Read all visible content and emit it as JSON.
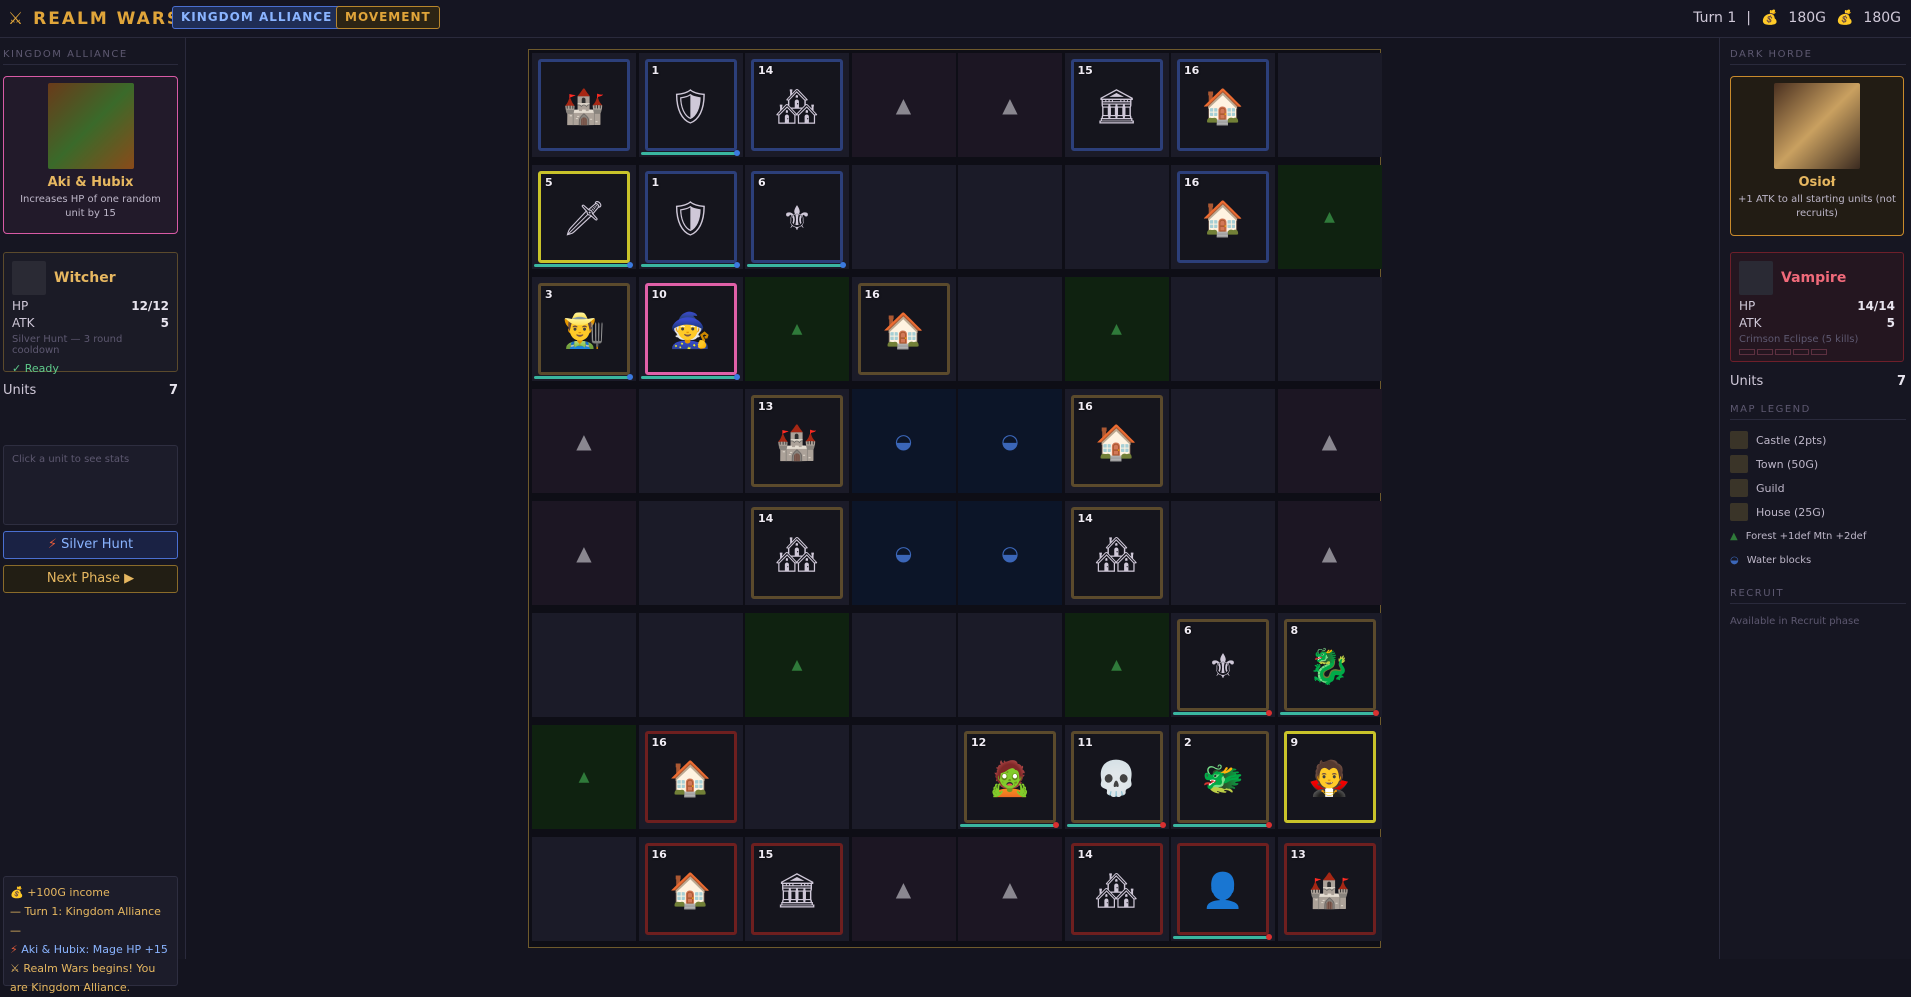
{
  "header": {
    "logo": "⚔ REALM WARS",
    "team_pill": "KINGDOM ALLIANCE",
    "phase_pill": "MOVEMENT",
    "turn": "Turn 1",
    "sep": "|",
    "gold_left": "180G",
    "gold_right": "180G"
  },
  "left": {
    "section": "KINGDOM ALLIANCE",
    "leader": {
      "name": "Aki & Hubix",
      "desc": "Increases HP of one random unit by 15"
    },
    "unit": {
      "name": "Witcher",
      "hp_label": "HP",
      "hp": "12/12",
      "atk_label": "ATK",
      "atk": "5",
      "skill": "Silver Hunt — 3 round cooldown",
      "ready": "✓ Ready"
    },
    "units_label": "Units",
    "units": "7",
    "info_placeholder": "Click a unit to see stats",
    "skill_button": "Silver Hunt",
    "next_button": "Next Phase ▶",
    "log": [
      "+100G income",
      "— Turn 1: Kingdom Alliance —",
      "Aki & Hubix: Mage HP +15",
      "⚔ Realm Wars begins! You are Kingdom Alliance."
    ]
  },
  "right": {
    "section": "DARK HORDE",
    "leader": {
      "name": "Osioł",
      "desc": "+1 ATK to all starting units (not recruits)"
    },
    "unit": {
      "name": "Vampire",
      "hp_label": "HP",
      "hp": "14/14",
      "atk_label": "ATK",
      "atk": "5",
      "skill": "Crimson Eclipse (5 kills)"
    },
    "units_label": "Units",
    "units": "7",
    "legend_title": "MAP LEGEND",
    "legend": [
      "Castle (2pts)",
      "Town (50G)",
      "Guild",
      "House (25G)"
    ],
    "legend_terrain": "Forest +1def  Mtn +2def",
    "legend_water": "Water blocks",
    "recruit_title": "RECRUIT",
    "recruit_text": "Available in Recruit phase"
  },
  "colors": {
    "gold": "#e0a53a",
    "ally": "#4a6fd0",
    "enemy": "#d83030",
    "bar": "#3ab6a0"
  },
  "board": {
    "rows": 8,
    "cols": 8,
    "cells": [
      [
        "tile:neutral-ally::castle-icon:",
        "tile:ally:1:knight-icon:blue",
        "tile:ally:14:town-icon:",
        "mountain",
        "mountain",
        "tile:ally:15:guild-icon:",
        "tile:ally:16:house-icon:",
        "plain"
      ],
      [
        "tile:leader-ally:5:witcher-icon:blue",
        "tile:ally:1:knight-icon:blue",
        "tile:ally:6:paladin-icon:blue",
        "plain",
        "plain",
        "plain",
        "tile:ally:16:house-icon:",
        "forest"
      ],
      [
        "tile:neutral:3:peasant-icon:blue",
        "tile:sel:10:wizard-icon:blue",
        "forest",
        "tile:neutral:16:house-icon:",
        "plain",
        "forest",
        "plain",
        "plain"
      ],
      [
        "mountain",
        "plain",
        "tile:neutral:13:castle-icon:",
        "water",
        "water",
        "tile:neutral:16:house-icon:",
        "plain",
        "mountain"
      ],
      [
        "mountain",
        "plain",
        "tile:neutral:14:town-icon:",
        "water",
        "water",
        "tile:neutral:14:town-icon:",
        "plain",
        "mountain"
      ],
      [
        "plain",
        "plain",
        "forest",
        "plain",
        "plain",
        "forest",
        "tile:neutral:6:paladin-icon:red",
        "tile:neutral:8:dragon-icon:red"
      ],
      [
        "forest",
        "tile:enemy:16:house-icon:",
        "plain",
        "plain",
        "tile:neutral:12:zombie-icon:red",
        "tile:neutral:11:ghoul-icon:red",
        "tile:neutral:2:red-dragon-icon:red",
        "tile:leader-enemy:9:vampire-icon:"
      ],
      [
        "plain",
        "tile:enemy:16:house-icon:",
        "tile:enemy:15:guild-icon:",
        "mountain",
        "mountain",
        "tile:enemy:14:town-icon:",
        "tile:enemy::leader-portrait-icon:red",
        "tile:enemy:13:castle-icon:"
      ]
    ]
  }
}
